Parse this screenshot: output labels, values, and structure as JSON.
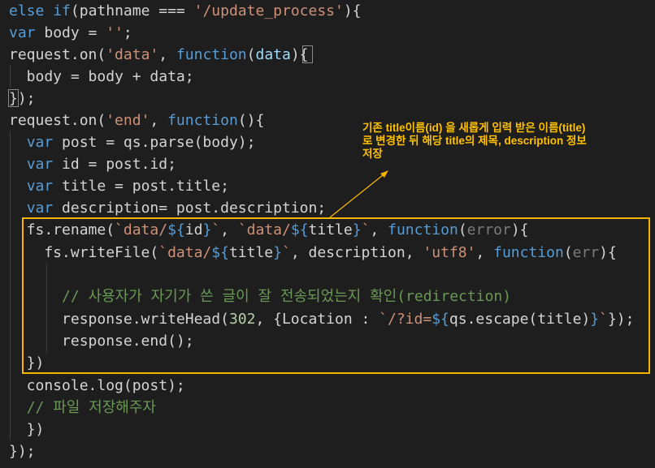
{
  "colors": {
    "background": "#1e1e1e",
    "keyword": "#569cd6",
    "function_keyword": "#569cd6",
    "identifier": "#d4d4d4",
    "string": "#ce9178",
    "variable": "#9cdcfe",
    "comment": "#6a9955",
    "number": "#b5cea8",
    "param_dim": "#7a7a7a",
    "highlight_border": "#f4b400",
    "annotation_text": "#ffc000"
  },
  "annotation": {
    "text": "기존 title이름(id) 을 새롭게 입력 받은 이름(title)\n로 변경한 뒤 해당 title의 제목, description 정보\n저장"
  },
  "code_lines": [
    [
      {
        "t": "else",
        "c": "keyword"
      },
      {
        "t": " ",
        "c": "identifier"
      },
      {
        "t": "if",
        "c": "keyword"
      },
      {
        "t": "(pathname === ",
        "c": "identifier"
      },
      {
        "t": "'/update_process'",
        "c": "string"
      },
      {
        "t": "){",
        "c": "identifier"
      }
    ],
    [
      {
        "t": "var",
        "c": "keyword"
      },
      {
        "t": " body = ",
        "c": "identifier"
      },
      {
        "t": "''",
        "c": "string"
      },
      {
        "t": ";",
        "c": "identifier"
      }
    ],
    [
      {
        "t": "request.on(",
        "c": "identifier"
      },
      {
        "t": "'data'",
        "c": "string"
      },
      {
        "t": ", ",
        "c": "identifier"
      },
      {
        "t": "function",
        "c": "function_keyword"
      },
      {
        "t": "(",
        "c": "identifier"
      },
      {
        "t": "data",
        "c": "variable"
      },
      {
        "t": "){",
        "c": "identifier"
      }
    ],
    [
      {
        "t": "  body = body + data;",
        "c": "identifier"
      }
    ],
    [
      {
        "t": "});",
        "c": "identifier"
      }
    ],
    [
      {
        "t": "request.on(",
        "c": "identifier"
      },
      {
        "t": "'end'",
        "c": "string"
      },
      {
        "t": ", ",
        "c": "identifier"
      },
      {
        "t": "function",
        "c": "function_keyword"
      },
      {
        "t": "(){",
        "c": "identifier"
      }
    ],
    [
      {
        "t": "  ",
        "c": "identifier"
      },
      {
        "t": "var",
        "c": "keyword"
      },
      {
        "t": " post = qs.parse(body);",
        "c": "identifier"
      }
    ],
    [
      {
        "t": "  ",
        "c": "identifier"
      },
      {
        "t": "var",
        "c": "keyword"
      },
      {
        "t": " id = post.id;",
        "c": "identifier"
      }
    ],
    [
      {
        "t": "  ",
        "c": "identifier"
      },
      {
        "t": "var",
        "c": "keyword"
      },
      {
        "t": " title = post.title;",
        "c": "identifier"
      }
    ],
    [
      {
        "t": "  ",
        "c": "identifier"
      },
      {
        "t": "var",
        "c": "keyword"
      },
      {
        "t": " description= post.description;",
        "c": "identifier"
      }
    ],
    [
      {
        "t": "  fs.rename(",
        "c": "identifier"
      },
      {
        "t": "`data/",
        "c": "string"
      },
      {
        "t": "${",
        "c": "keyword"
      },
      {
        "t": "id",
        "c": "identifier"
      },
      {
        "t": "}",
        "c": "keyword"
      },
      {
        "t": "`",
        "c": "string"
      },
      {
        "t": ", ",
        "c": "identifier"
      },
      {
        "t": "`data/",
        "c": "string"
      },
      {
        "t": "${",
        "c": "keyword"
      },
      {
        "t": "title",
        "c": "identifier"
      },
      {
        "t": "}",
        "c": "keyword"
      },
      {
        "t": "`",
        "c": "string"
      },
      {
        "t": ", ",
        "c": "identifier"
      },
      {
        "t": "function",
        "c": "function_keyword"
      },
      {
        "t": "(",
        "c": "identifier"
      },
      {
        "t": "error",
        "c": "param_dim"
      },
      {
        "t": "){",
        "c": "identifier"
      }
    ],
    [
      {
        "t": "    fs.writeFile(",
        "c": "identifier"
      },
      {
        "t": "`data/",
        "c": "string"
      },
      {
        "t": "${",
        "c": "keyword"
      },
      {
        "t": "title",
        "c": "identifier"
      },
      {
        "t": "}",
        "c": "keyword"
      },
      {
        "t": "`",
        "c": "string"
      },
      {
        "t": ", description, ",
        "c": "identifier"
      },
      {
        "t": "'utf8'",
        "c": "string"
      },
      {
        "t": ", ",
        "c": "identifier"
      },
      {
        "t": "function",
        "c": "function_keyword"
      },
      {
        "t": "(",
        "c": "identifier"
      },
      {
        "t": "err",
        "c": "param_dim"
      },
      {
        "t": "){",
        "c": "identifier"
      }
    ],
    [
      {
        "t": "",
        "c": "identifier"
      }
    ],
    [
      {
        "t": "      ",
        "c": "identifier"
      },
      {
        "t": "// 사용자가 자기가 쓴 글이 잘 전송되었는지 확인(redirection)",
        "c": "comment"
      }
    ],
    [
      {
        "t": "      response.writeHead(",
        "c": "identifier"
      },
      {
        "t": "302",
        "c": "number"
      },
      {
        "t": ", {Location : ",
        "c": "identifier"
      },
      {
        "t": "`/?id=",
        "c": "string"
      },
      {
        "t": "${",
        "c": "keyword"
      },
      {
        "t": "qs.escape(title)",
        "c": "identifier"
      },
      {
        "t": "}",
        "c": "keyword"
      },
      {
        "t": "`",
        "c": "string"
      },
      {
        "t": "});",
        "c": "identifier"
      }
    ],
    [
      {
        "t": "      response.end();",
        "c": "identifier"
      }
    ],
    [
      {
        "t": "  })",
        "c": "identifier"
      }
    ],
    [
      {
        "t": "  console.log(post);",
        "c": "identifier"
      }
    ],
    [
      {
        "t": "  ",
        "c": "identifier"
      },
      {
        "t": "// 파일 저장해주자",
        "c": "comment"
      }
    ],
    [
      {
        "t": "  })",
        "c": "identifier"
      }
    ],
    [
      {
        "t": "});",
        "c": "identifier"
      }
    ]
  ]
}
